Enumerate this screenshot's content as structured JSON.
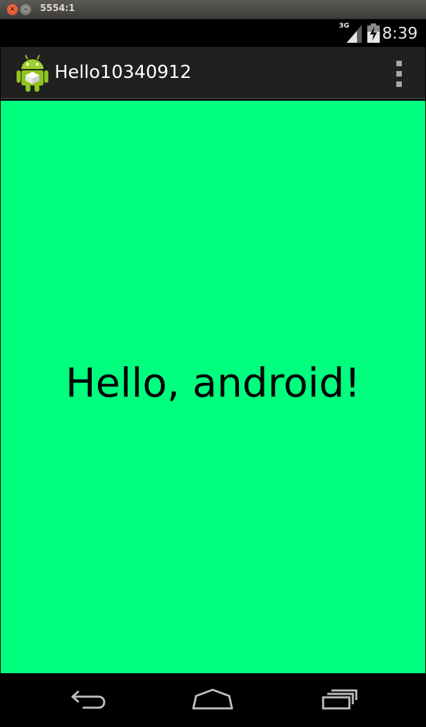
{
  "window": {
    "title": "5554:1",
    "close_glyph": "×",
    "minimize_glyph": "–"
  },
  "status_bar": {
    "network": "3G",
    "time": "8:39",
    "icons": [
      "signal-3g-icon",
      "battery-charging-icon"
    ]
  },
  "action_bar": {
    "app_icon": "android-robot-icon",
    "title": "Hello10340912",
    "overflow_icon": "overflow-menu-icon"
  },
  "content": {
    "background_color": "#00ff7f",
    "message": "Hello, android!"
  },
  "nav_bar": {
    "buttons": [
      "back-icon",
      "home-icon",
      "recent-apps-icon"
    ]
  }
}
